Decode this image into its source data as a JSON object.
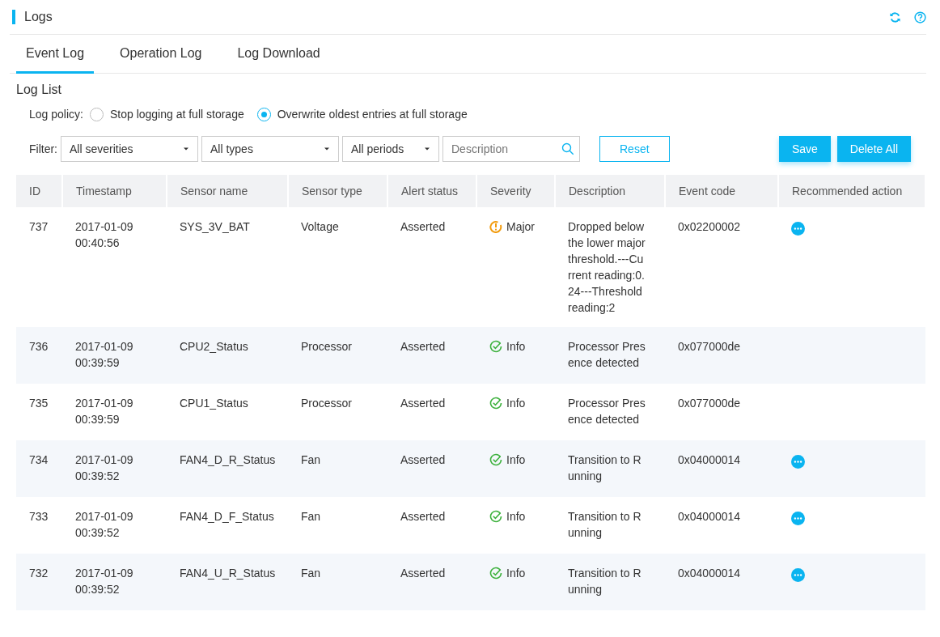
{
  "page": {
    "title": "Logs"
  },
  "tabs": [
    {
      "label": "Event Log",
      "selected": true
    },
    {
      "label": "Operation Log",
      "selected": false
    },
    {
      "label": "Log Download",
      "selected": false
    }
  ],
  "section_title": "Log List",
  "log_policy": {
    "label": "Log policy:",
    "options": [
      {
        "label": "Stop logging at full storage",
        "selected": false
      },
      {
        "label": "Overwrite oldest entries at full storage",
        "selected": true
      }
    ]
  },
  "filter": {
    "label": "Filter:",
    "severity": "All severities",
    "type": "All types",
    "period": "All periods",
    "search_placeholder": "Description",
    "reset": "Reset"
  },
  "buttons": {
    "save": "Save",
    "delete_all": "Delete All"
  },
  "table": {
    "columns": [
      "ID",
      "Timestamp",
      "Sensor name",
      "Sensor type",
      "Alert status",
      "Severity",
      "Description",
      "Event code",
      "Recommended action"
    ],
    "rows": [
      {
        "id": "737",
        "timestamp": "2017-01-09 00:40:56",
        "sensor_name": "SYS_3V_BAT",
        "sensor_type": "Voltage",
        "alert_status": "Asserted",
        "severity": {
          "kind": "major",
          "label": "Major"
        },
        "description": "Dropped below the lower major threshold.---Current reading:0.24---Threshold reading:2",
        "event_code": "0x02200002",
        "has_action": true
      },
      {
        "id": "736",
        "timestamp": "2017-01-09 00:39:59",
        "sensor_name": "CPU2_Status",
        "sensor_type": "Processor",
        "alert_status": "Asserted",
        "severity": {
          "kind": "info",
          "label": "Info"
        },
        "description": "Processor Presence detected",
        "event_code": "0x077000de",
        "has_action": false
      },
      {
        "id": "735",
        "timestamp": "2017-01-09 00:39:59",
        "sensor_name": "CPU1_Status",
        "sensor_type": "Processor",
        "alert_status": "Asserted",
        "severity": {
          "kind": "info",
          "label": "Info"
        },
        "description": "Processor Presence detected",
        "event_code": "0x077000de",
        "has_action": false
      },
      {
        "id": "734",
        "timestamp": "2017-01-09 00:39:52",
        "sensor_name": "FAN4_D_R_Status",
        "sensor_type": "Fan",
        "alert_status": "Asserted",
        "severity": {
          "kind": "info",
          "label": "Info"
        },
        "description": "Transition to Running",
        "event_code": "0x04000014",
        "has_action": true
      },
      {
        "id": "733",
        "timestamp": "2017-01-09 00:39:52",
        "sensor_name": "FAN4_D_F_Status",
        "sensor_type": "Fan",
        "alert_status": "Asserted",
        "severity": {
          "kind": "info",
          "label": "Info"
        },
        "description": "Transition to Running",
        "event_code": "0x04000014",
        "has_action": true
      },
      {
        "id": "732",
        "timestamp": "2017-01-09 00:39:52",
        "sensor_name": "FAN4_U_R_Status",
        "sensor_type": "Fan",
        "alert_status": "Asserted",
        "severity": {
          "kind": "info",
          "label": "Info"
        },
        "description": "Transition to Running",
        "event_code": "0x04000014",
        "has_action": true
      }
    ]
  }
}
